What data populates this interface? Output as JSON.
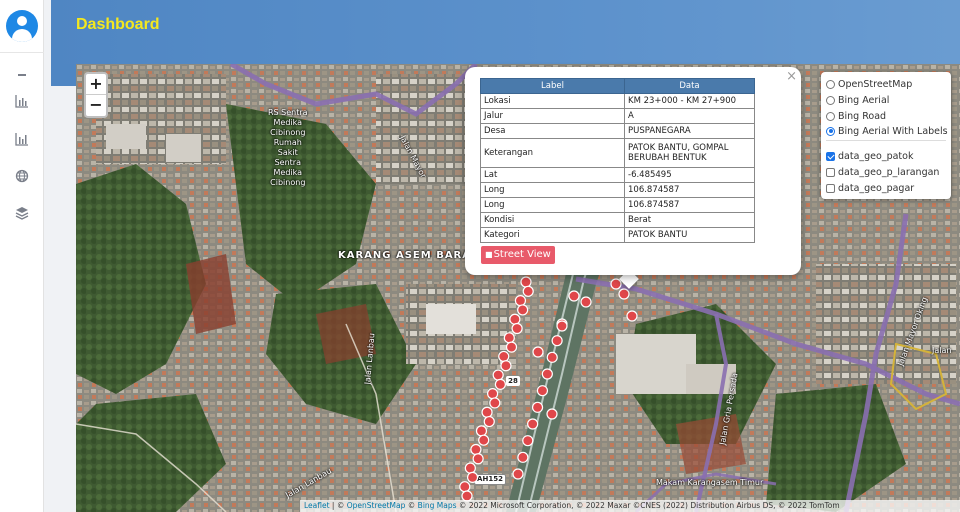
{
  "header": {
    "title": "Dashboard"
  },
  "sidebar": {
    "items": [
      {
        "icon": "menu-icon"
      },
      {
        "icon": "bar-chart-icon"
      },
      {
        "icon": "bar-chart-icon"
      },
      {
        "icon": "globe-icon"
      },
      {
        "icon": "layers-icon"
      }
    ]
  },
  "map": {
    "zoom_in": "+",
    "zoom_out": "−",
    "labels": {
      "hospital": [
        "RS Sentra",
        "Medika",
        "Cibinong",
        "Rumah",
        "Sakit",
        "Sentra",
        "Medika",
        "Cibinong"
      ],
      "area": "KARANG ASEM BARA",
      "road_right": "Jalan Mayor Oking",
      "road_top": "Jalan Mayor",
      "road_gria": "Jalan Gria Persada",
      "road_lanbau": "Jalan Lanbau",
      "road_lanbau2": "Jalan Lanbau",
      "street_bottom": "Makam Karangasem Timur",
      "shield_28": "28",
      "shield_ah152": "AH152",
      "jalan_edge": "Jalan"
    }
  },
  "popup": {
    "close": "×",
    "headers": [
      "Label",
      "Data"
    ],
    "rows": [
      {
        "label": "Lokasi",
        "value": "KM 23+000 - KM 27+900"
      },
      {
        "label": "Jalur",
        "value": "A"
      },
      {
        "label": "Desa",
        "value": "PUSPANEGARA"
      },
      {
        "label": "Keterangan",
        "value": "PATOK BANTU, GOMPAL BERUBAH BENTUK"
      },
      {
        "label": "Lat",
        "value": "-6.485495"
      },
      {
        "label": "Long",
        "value": "106.874587"
      },
      {
        "label": "Long",
        "value": "106.874587"
      },
      {
        "label": "Kondisi",
        "value": "Berat"
      },
      {
        "label": "Kategori",
        "value": "PATOK BANTU"
      }
    ],
    "street_view_button": "Street View"
  },
  "layers": {
    "base": [
      {
        "label": "OpenStreetMap",
        "selected": false
      },
      {
        "label": "Bing Aerial",
        "selected": false
      },
      {
        "label": "Bing Road",
        "selected": false
      },
      {
        "label": "Bing Aerial With Labels",
        "selected": true
      }
    ],
    "overlays": [
      {
        "label": "data_geo_patok",
        "checked": true
      },
      {
        "label": "data_geo_p_larangan",
        "checked": false
      },
      {
        "label": "data_geo_pagar",
        "checked": false
      }
    ]
  },
  "attribution": {
    "leaflet": "Leaflet",
    "sep": " | © ",
    "osm": "OpenStreetMap",
    "bing_prefix": " © ",
    "bing": "Bing Maps",
    "rest": " © 2022 Microsoft Corporation, © 2022 Maxar ©CNES (2022) Distribution Airbus DS, © 2022 TomTom"
  },
  "colors": {
    "header": "#4f86c3",
    "title": "#f4e81f",
    "marker": "#e0474a",
    "route": "#8a6fb0",
    "table_header": "#4a7aab",
    "button": "#e85a6a"
  }
}
